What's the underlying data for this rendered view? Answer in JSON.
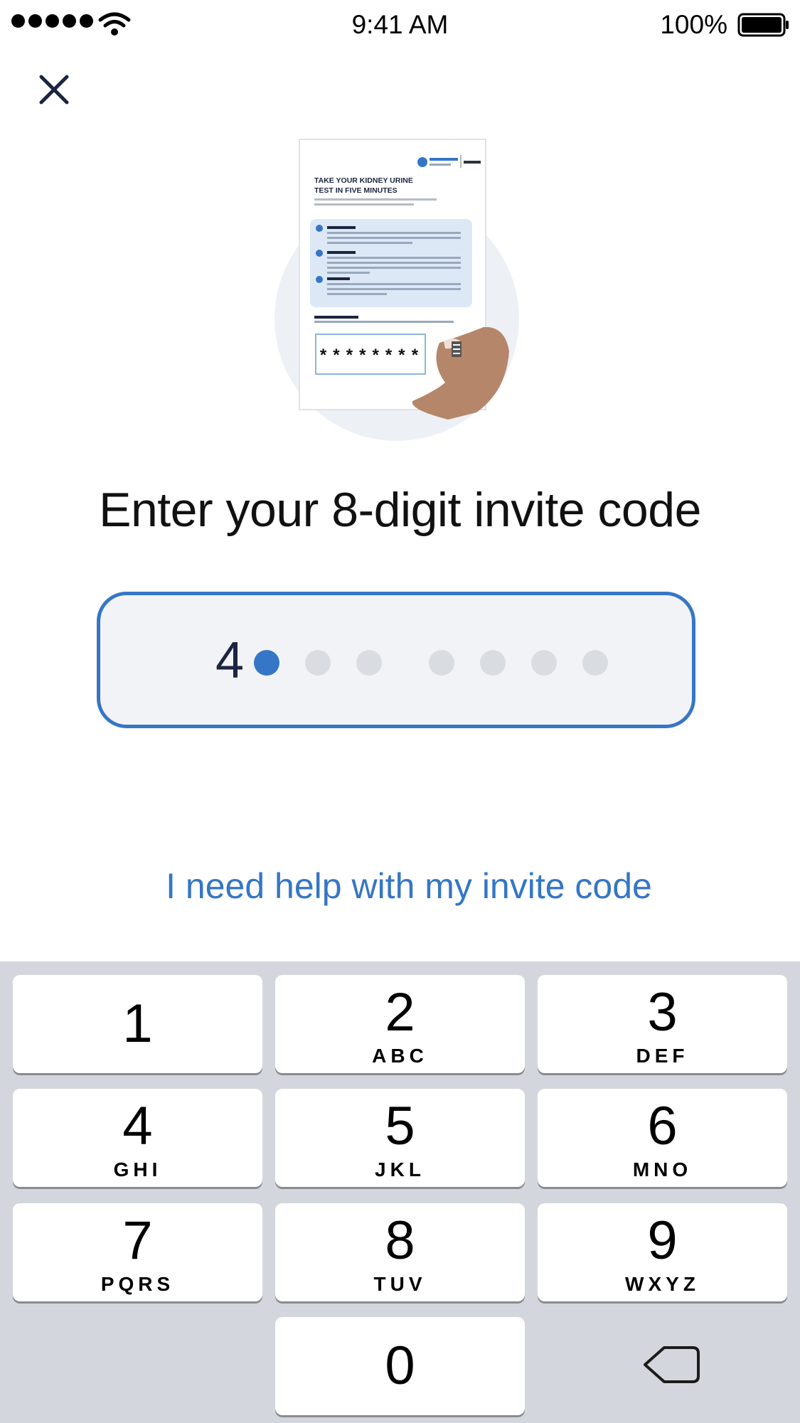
{
  "status_bar": {
    "time": "9:41 AM",
    "battery": "100%"
  },
  "icons": {
    "close": "close-icon",
    "delete": "backspace-icon"
  },
  "illustration": {
    "title_line1": "TAKE YOUR KIDNEY URINE",
    "title_line2": "TEST IN FIVE MINUTES",
    "code_mask": "********"
  },
  "heading": "Enter your 8-digit invite code",
  "code_input": {
    "entered_digit": "4",
    "total_digits": 8,
    "entered_count": 1
  },
  "help_link": "I need help with my invite code",
  "keypad": {
    "keys": [
      {
        "number": "1",
        "letters": ""
      },
      {
        "number": "2",
        "letters": "ABC"
      },
      {
        "number": "3",
        "letters": "DEF"
      },
      {
        "number": "4",
        "letters": "GHI"
      },
      {
        "number": "5",
        "letters": "JKL"
      },
      {
        "number": "6",
        "letters": "MNO"
      },
      {
        "number": "7",
        "letters": "PQRS"
      },
      {
        "number": "8",
        "letters": "TUV"
      },
      {
        "number": "9",
        "letters": "WXYZ"
      },
      {
        "number": "0",
        "letters": ""
      }
    ]
  },
  "colors": {
    "accent": "#3576c6",
    "field_bg": "#f1f3f6",
    "keypad_bg": "#d3d6dc"
  }
}
